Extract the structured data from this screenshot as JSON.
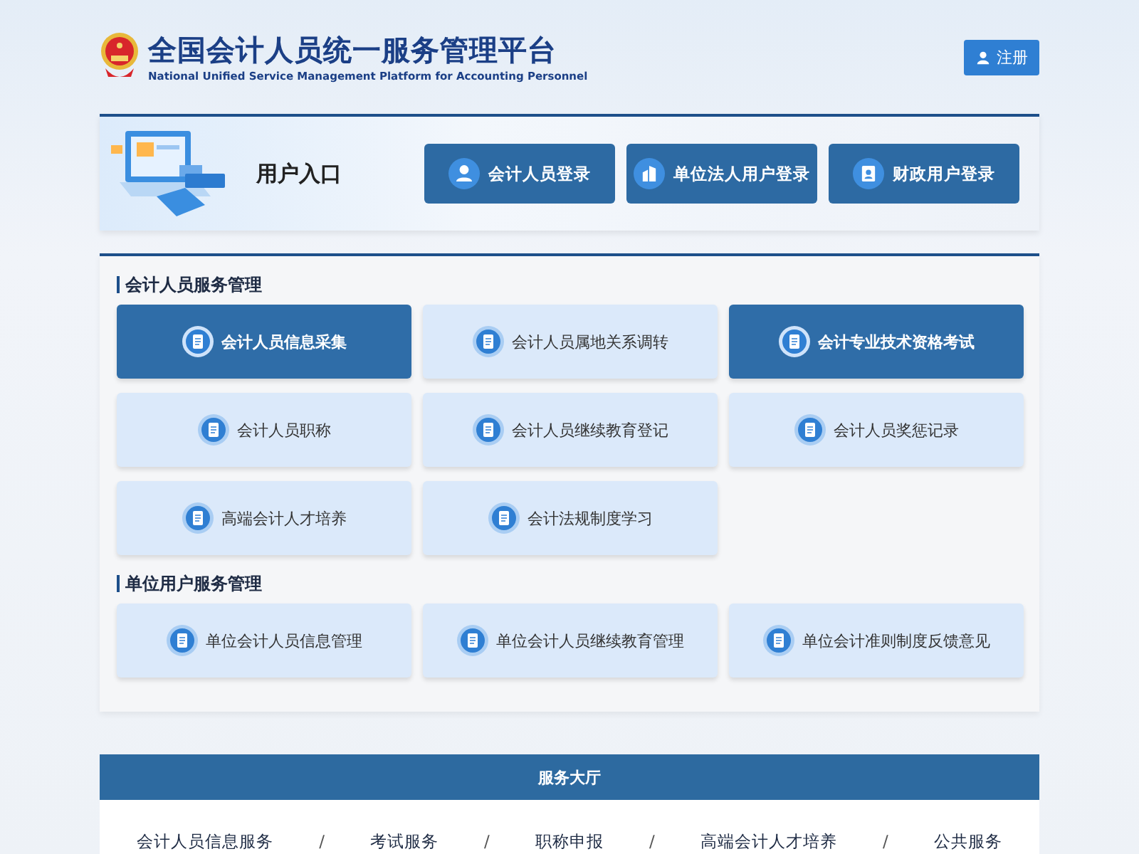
{
  "header": {
    "title": "全国会计人员统一服务管理平台",
    "subtitle": "National Unified Service Management Platform for Accounting Personnel",
    "register_button": "注册"
  },
  "login_panel": {
    "title": "用户入口",
    "buttons": [
      {
        "label": "会计人员登录",
        "kind": "person"
      },
      {
        "label": "单位法人用户登录",
        "kind": "building"
      },
      {
        "label": "财政用户登录",
        "kind": "badge"
      }
    ]
  },
  "services": [
    {
      "heading": "会计人员服务管理",
      "tiles": [
        {
          "label": "会计人员信息采集",
          "highlighted": true
        },
        {
          "label": "会计人员属地关系调转",
          "highlighted": false
        },
        {
          "label": "会计专业技术资格考试",
          "highlighted": true
        },
        {
          "label": "会计人员职称",
          "highlighted": false
        },
        {
          "label": "会计人员继续教育登记",
          "highlighted": false
        },
        {
          "label": "会计人员奖惩记录",
          "highlighted": false
        },
        {
          "label": "高端会计人才培养",
          "highlighted": false
        },
        {
          "label": "会计法规制度学习",
          "highlighted": false
        }
      ]
    },
    {
      "heading": "单位用户服务管理",
      "tiles": [
        {
          "label": "单位会计人员信息管理",
          "highlighted": false
        },
        {
          "label": "单位会计人员继续教育管理",
          "highlighted": false
        },
        {
          "label": "单位会计准则制度反馈意见",
          "highlighted": false
        }
      ]
    }
  ],
  "service_hall": {
    "title": "服务大厅",
    "nav": [
      "会计人员信息服务",
      "/",
      "考试服务",
      "/",
      "职称申报",
      "/",
      "高端会计人才培养",
      "/",
      "公共服务"
    ]
  }
}
